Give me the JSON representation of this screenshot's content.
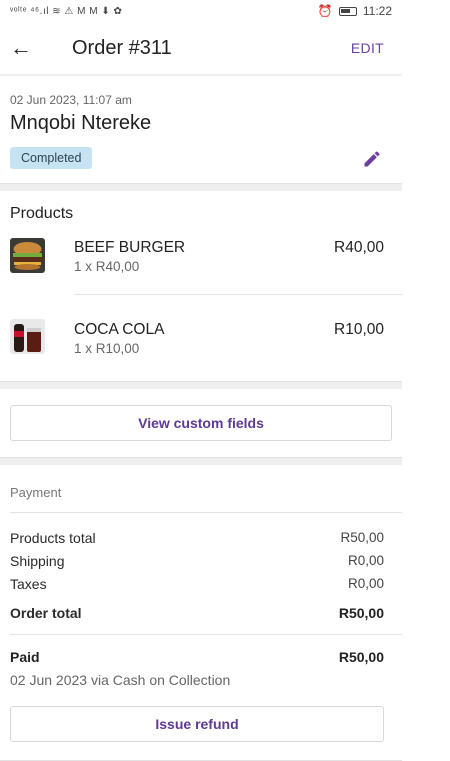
{
  "status_bar": {
    "left_icons": "ᵛᵒˡᵗᵉ ⁴⁶.ıl ≋ ⚠ M M ⬇ ✿",
    "time": "11:22"
  },
  "app_bar": {
    "back_icon": "arrow-left-icon",
    "title": "Order #311",
    "edit_label": "EDIT"
  },
  "order": {
    "date": "02 Jun 2023, 11:07 am",
    "customer": "Mnqobi Ntereke",
    "status": "Completed",
    "status_color": "#c6e3f3"
  },
  "products": {
    "title": "Products",
    "items": [
      {
        "name": "BEEF BURGER",
        "qty": "1 x R40,00",
        "price": "R40,00",
        "icon": "burger-image"
      },
      {
        "name": "COCA COLA",
        "qty": "1 x R10,00",
        "price": "R10,00",
        "icon": "cola-image"
      }
    ]
  },
  "custom_fields": {
    "label": "View custom fields"
  },
  "payment": {
    "title": "Payment",
    "rows": [
      {
        "label": "Products total",
        "value": "R50,00"
      },
      {
        "label": "Shipping",
        "value": "R0,00"
      },
      {
        "label": "Taxes",
        "value": "R0,00"
      }
    ],
    "order_total_label": "Order total",
    "order_total_value": "R50,00",
    "paid_label": "Paid",
    "paid_value": "R50,00",
    "paid_detail": "02 Jun 2023 via Cash on Collection",
    "refund_label": "Issue refund"
  },
  "colors": {
    "accent": "#6b3fa0"
  }
}
